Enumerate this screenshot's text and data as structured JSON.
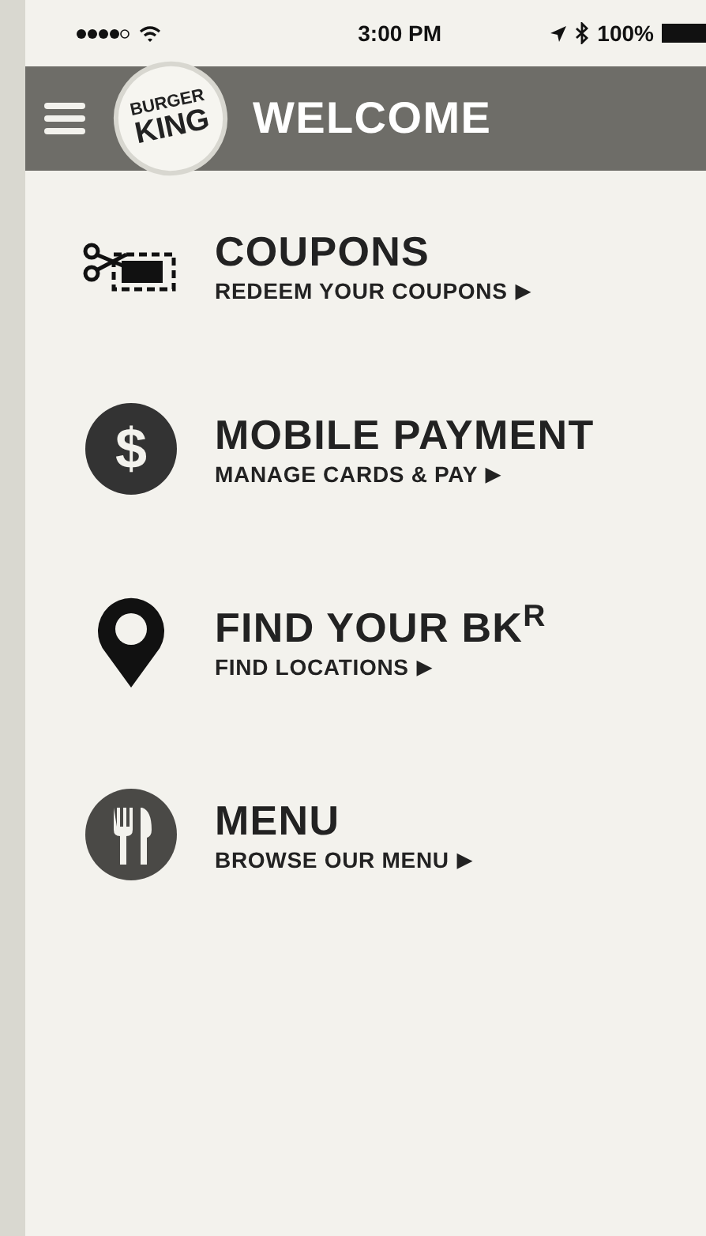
{
  "status_bar": {
    "time": "3:00 PM",
    "battery": "100%"
  },
  "header": {
    "logo": {
      "line_1": "BURGER",
      "line_2": "KING"
    },
    "title": "WELCOME"
  },
  "items": [
    {
      "kind": "coupon",
      "title": "COUPONS",
      "subtitle": "REDEEM YOUR COUPONS",
      "arrow": "▶"
    },
    {
      "kind": "payment",
      "icon": "$",
      "title": "MOBILE PAYMENT",
      "subtitle": "MANAGE CARDS & PAY",
      "arrow": "▶"
    },
    {
      "kind": "location",
      "title": "FIND YOUR BK$^{R}$",
      "subtitle": "FIND LOCATIONS",
      "arrow": "▶"
    },
    {
      "kind": "menu",
      "title": "MENU",
      "subtitle": "BROWSE OUR MENU",
      "arrow": "▶"
    }
  ]
}
